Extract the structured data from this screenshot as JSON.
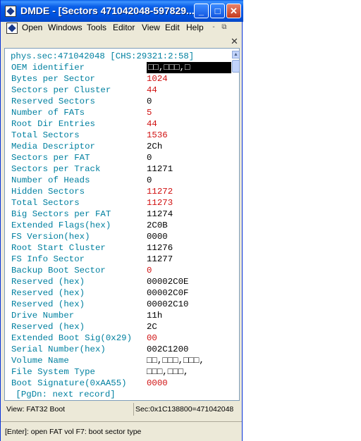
{
  "window": {
    "title": "DMDE - [Sectors 471042048-597829...",
    "minimize_glyph": "_",
    "maximize_glyph": "□",
    "close_glyph": "✕"
  },
  "menu": {
    "open": "Open",
    "windows": "Windows",
    "tools": "Tools",
    "editor": "Editor",
    "view": "View",
    "edit": "Edit",
    "help": "Help",
    "restore_glyph": "-",
    "mdi_restore_glyph": "⧉",
    "doc_close_glyph": "✕"
  },
  "header": "phys.sec:471042048 [CHS:29321:2:58]",
  "fields": [
    {
      "label": "OEM identifier",
      "value": "□□,□□□,□"
    },
    {
      "label": "Bytes per Sector",
      "value": "1024"
    },
    {
      "label": "Sectors per Cluster",
      "value": "44"
    },
    {
      "label": "Reserved Sectors",
      "value": "0"
    },
    {
      "label": "Number of FATs",
      "value": "5"
    },
    {
      "label": "Root Dir Entries",
      "value": "44"
    },
    {
      "label": "Total Sectors",
      "value": "1536"
    },
    {
      "label": "Media Descriptor",
      "value": "2Ch"
    },
    {
      "label": "Sectors per FAT",
      "value": "0"
    },
    {
      "label": "Sectors per Track",
      "value": "11271"
    },
    {
      "label": "Number of Heads",
      "value": "0"
    },
    {
      "label": "Hidden Sectors",
      "value": "11272"
    },
    {
      "label": "Total Sectors",
      "value": "11273"
    },
    {
      "label": "Big Sectors per FAT",
      "value": "11274"
    },
    {
      "label": "Extended Flags(hex)",
      "value": "2C0B"
    },
    {
      "label": "FS Version(hex)",
      "value": "0000"
    },
    {
      "label": "Root Start Cluster",
      "value": "11276"
    },
    {
      "label": "FS Info Sector",
      "value": "11277"
    },
    {
      "label": "Backup Boot Sector",
      "value": "0"
    },
    {
      "label": "Reserved (hex)",
      "value": "00002C0E"
    },
    {
      "label": "Reserved (hex)",
      "value": "00002C0F"
    },
    {
      "label": "Reserved (hex)",
      "value": "00002C10"
    },
    {
      "label": "Drive Number",
      "value": "11h"
    },
    {
      "label": "Reserved (hex)",
      "value": "2C"
    },
    {
      "label": "Extended Boot Sig(0x29)",
      "value": "00"
    },
    {
      "label": "Serial Number(hex)",
      "value": "002C1200"
    },
    {
      "label": "Volume Name",
      "value": "□□,□□□,□□□,"
    },
    {
      "label": "File System Type",
      "value": "□□□,□□□,"
    },
    {
      "label": "Boot Signature(0xAA55)",
      "value": "0000"
    }
  ],
  "footer_line": " [PgDn: next record]",
  "status": {
    "left": "View: FAT32 Boot",
    "right": "Sec:0x1C138800=471042048"
  },
  "keyhint": "[Enter]: open FAT vol    F7: boot sector type",
  "colors": {
    "label": "#0080a0",
    "value_error": "#d01010",
    "value_normal": "#000000"
  }
}
